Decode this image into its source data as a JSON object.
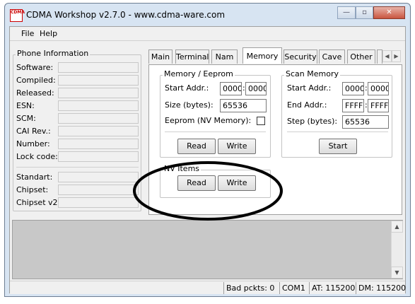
{
  "window": {
    "icon_text": "CDMA",
    "title": "CDMA Workshop v2.7.0  -  www.cdma-ware.com",
    "minimize_glyph": "—",
    "maximize_glyph": "▫",
    "close_glyph": "✕"
  },
  "menu": {
    "file": "File",
    "help": "Help"
  },
  "phone_info": {
    "title": "Phone Information",
    "labels": [
      "Software:",
      "Compiled:",
      "Released:",
      "ESN:",
      "SCM:",
      "CAI Rev.:",
      "Number:",
      "Lock code:"
    ],
    "labels2": [
      "Standart:",
      "Chipset:",
      "Chipset v2:"
    ]
  },
  "tabs": [
    "Main",
    "Terminal",
    "Nam",
    "Memory",
    "Security",
    "Cave",
    "Other"
  ],
  "tab_active": "Memory",
  "tab_scroll": {
    "left": "◀",
    "right": "▶"
  },
  "memory_eeprom": {
    "title": "Memory / Eeprom",
    "start_label": "Start Addr.:",
    "start_hi": "0000",
    "start_lo": "0000",
    "size_label": "Size (bytes):",
    "size_value": "65536",
    "eeprom_label": "Eeprom (NV Memory):",
    "eeprom_checked": false,
    "read": "Read",
    "write": "Write"
  },
  "scan_memory": {
    "title": "Scan Memory",
    "start_label": "Start Addr.:",
    "start_hi": "0000",
    "start_lo": "0000",
    "end_label": "End Addr.:",
    "end_hi": "FFFF",
    "end_lo": "FFFF",
    "step_label": "Step (bytes):",
    "step_value": "65536",
    "start_button": "Start"
  },
  "nv_items": {
    "title": "NV Items",
    "read": "Read",
    "write": "Write"
  },
  "addr_sep": ":",
  "log": {
    "up": "▲",
    "down": "▼"
  },
  "status": {
    "bad_packets": "Bad pckts: 0",
    "port": "COM1",
    "at": "AT: 115200",
    "dm": "DM: 115200"
  }
}
